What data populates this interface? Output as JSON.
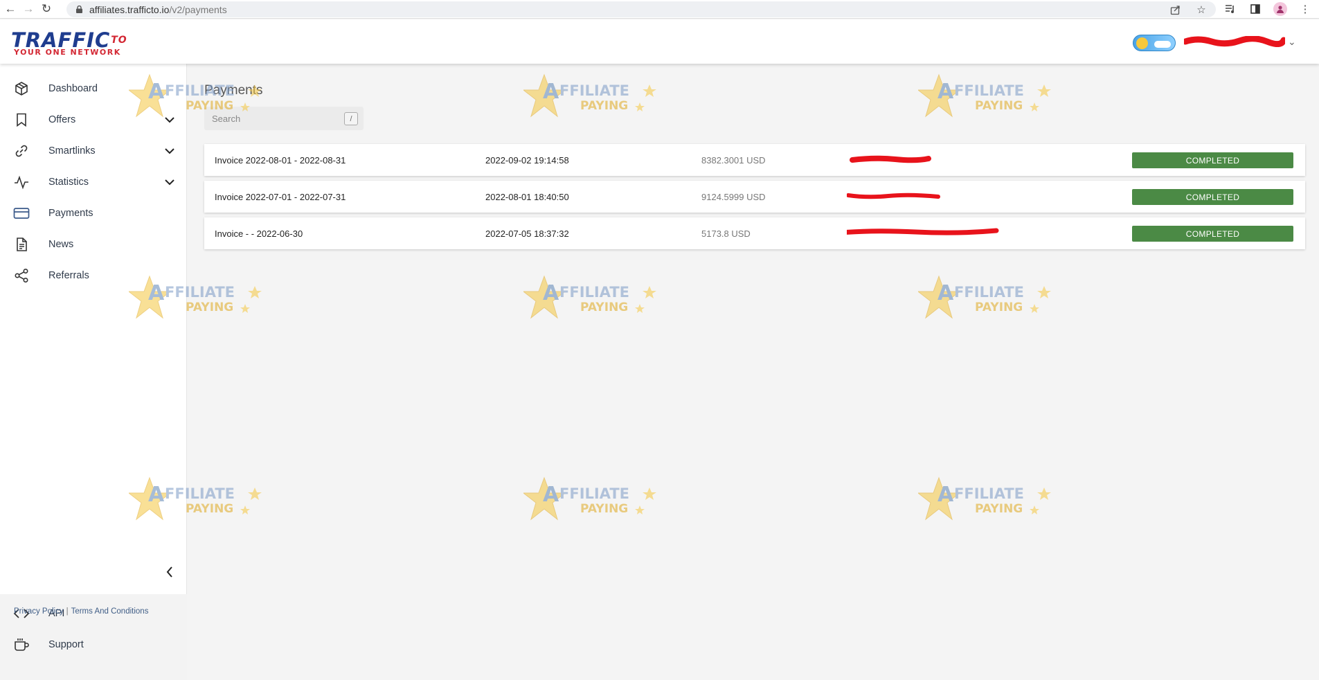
{
  "browser": {
    "url_host": "affiliates.trafficto.io",
    "url_path": "/v2/payments"
  },
  "logo": {
    "main": "TRAFFIC",
    "sup": "TO",
    "tagline": "YOUR ONE NETWORK"
  },
  "sidebar": {
    "items": [
      {
        "label": "Dashboard",
        "icon": "cube-icon"
      },
      {
        "label": "Offers",
        "icon": "bookmark-icon"
      },
      {
        "label": "Smartlinks",
        "icon": "link-icon"
      },
      {
        "label": "Statistics",
        "icon": "activity-icon"
      },
      {
        "label": "Payments",
        "icon": "credit-card-icon"
      },
      {
        "label": "News",
        "icon": "document-icon"
      },
      {
        "label": "Referrals",
        "icon": "share-icon"
      }
    ],
    "footer_items": [
      {
        "label": "API",
        "icon": "code-icon"
      },
      {
        "label": "Support",
        "icon": "coffee-icon"
      }
    ],
    "legal": {
      "privacy": "Privacy Policy",
      "separator": "|",
      "terms": "Terms And Conditions"
    }
  },
  "main": {
    "title": "Payments",
    "search_placeholder": "Search",
    "search_shortcut": "/",
    "payments": [
      {
        "invoice": "Invoice 2022-08-01 - 2022-08-31",
        "date": "2022-09-02 19:14:58",
        "amount": "8382.3001 USD",
        "status": "COMPLETED"
      },
      {
        "invoice": "Invoice 2022-07-01 - 2022-07-31",
        "date": "2022-08-01 18:40:50",
        "amount": "9124.5999 USD",
        "status": "COMPLETED"
      },
      {
        "invoice": "Invoice - - 2022-06-30",
        "date": "2022-07-05 18:37:32",
        "amount": "5173.8 USD",
        "status": "COMPLETED"
      }
    ]
  },
  "watermark": {
    "line1": "AFFILIATE",
    "line2": "PAYING"
  },
  "colors": {
    "status_completed": "#4b8a45",
    "logo_blue": "#1f3d8f",
    "logo_red": "#d32733",
    "redaction": "#e8131b"
  }
}
